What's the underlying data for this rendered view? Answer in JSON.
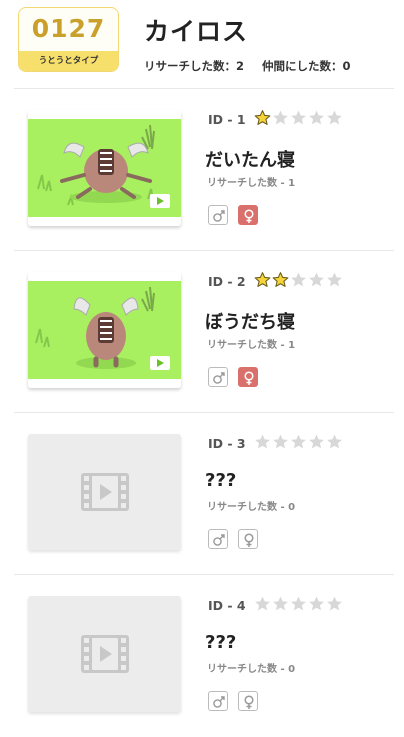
{
  "header": {
    "number": "0127",
    "sleep_type": "うとうとタイプ",
    "title": "カイロス",
    "research_count": "リサーチした数：2",
    "friend_count": "仲間にした数：0"
  },
  "entries": [
    {
      "id": "ID - 1",
      "stars": 1,
      "name": "だいたん寝",
      "research": "リサーチした数 - 1",
      "unlocked": true,
      "female_found": true
    },
    {
      "id": "ID - 2",
      "stars": 2,
      "name": "ぼうだち寝",
      "research": "リサーチした数 - 1",
      "unlocked": true,
      "female_found": true
    },
    {
      "id": "ID - 3",
      "stars": 0,
      "name": "???",
      "research": "リサーチした数 - 0",
      "unlocked": false,
      "female_found": false
    },
    {
      "id": "ID - 4",
      "stars": 0,
      "name": "???",
      "research": "リサーチした数 - 0",
      "unlocked": false,
      "female_found": false
    }
  ],
  "colors": {
    "star_filled": "#f5d43a",
    "star_empty": "#d8d8d8",
    "grass": "#a8f060",
    "female_active": "#d9706b"
  }
}
